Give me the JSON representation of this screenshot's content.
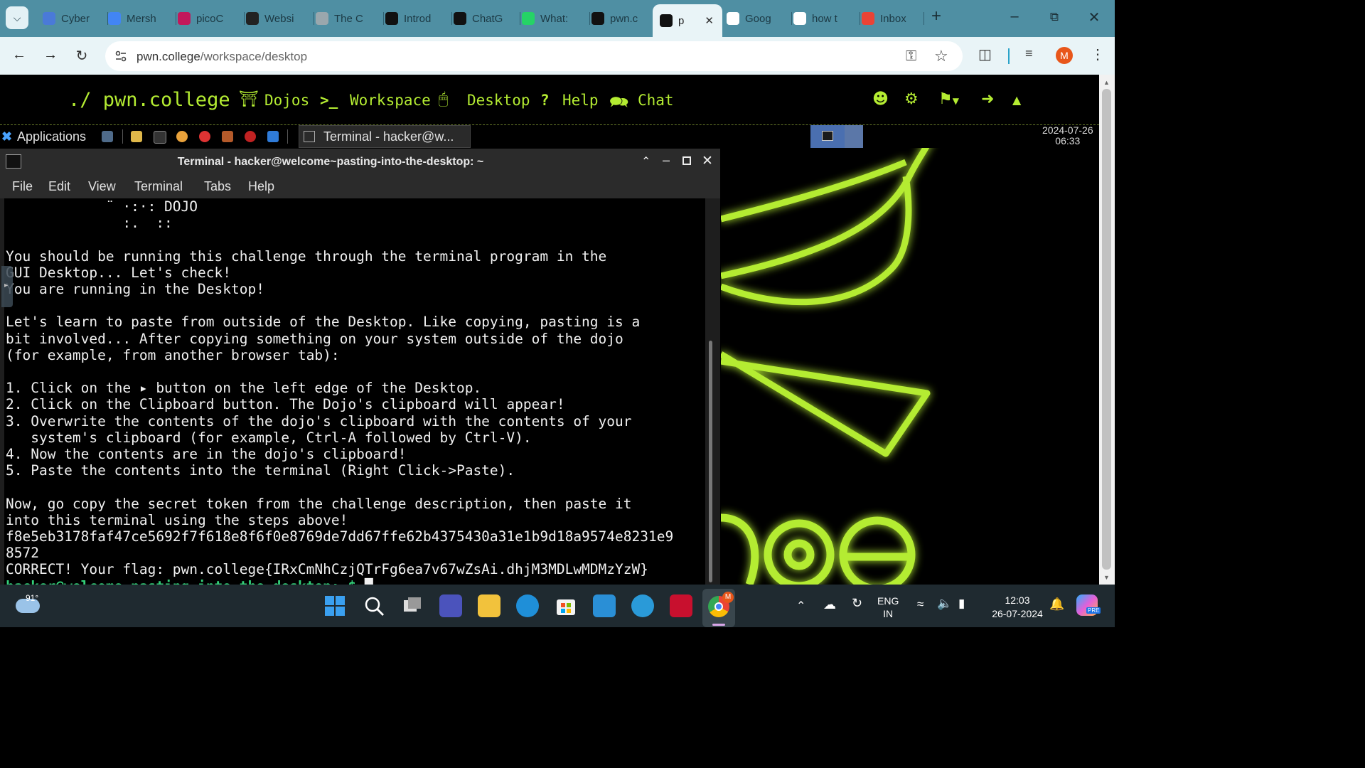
{
  "browser": {
    "tabs": [
      {
        "label": "Cyber",
        "icon": "cyber-icon",
        "color": "#4a7ad8"
      },
      {
        "label": "Mersh",
        "icon": "docs-icon",
        "color": "#4285f4"
      },
      {
        "label": "picoC",
        "icon": "picoctf-icon",
        "color": "#c2185b"
      },
      {
        "label": "Websi",
        "icon": "web-icon",
        "color": "#222222"
      },
      {
        "label": "The C",
        "icon": "loading-icon",
        "color": "#9aa7ad"
      },
      {
        "label": "Introd",
        "icon": "chatgpt-icon",
        "color": "#111111"
      },
      {
        "label": "ChatG",
        "icon": "chatgpt-icon",
        "color": "#111111"
      },
      {
        "label": "What:",
        "icon": "whatsapp-icon",
        "color": "#25d366"
      },
      {
        "label": "pwn.c",
        "icon": "pwn-icon",
        "color": "#111111"
      },
      {
        "label": "p",
        "icon": "pwn-icon",
        "color": "#111111",
        "active": true
      },
      {
        "label": "Goog",
        "icon": "google-icon",
        "color": "#ffffff"
      },
      {
        "label": "how t",
        "icon": "google-icon",
        "color": "#ffffff"
      },
      {
        "label": "Inbox",
        "icon": "gmail-icon",
        "color": "#ea4335"
      }
    ],
    "new_tab": "+",
    "url_host": "pwn.college",
    "url_path": "/workspace/desktop",
    "profile_initial": "M"
  },
  "site_nav": {
    "brand": "./ pwn.college",
    "items": [
      "Dojos",
      "Workspace",
      "Desktop",
      "Help",
      "Chat"
    ]
  },
  "xfce": {
    "applications": "Applications",
    "task": "Terminal - hacker@w...",
    "date": "2024-07-26",
    "time": "06:33"
  },
  "terminal": {
    "title": "Terminal - hacker@welcome~pasting-into-the-desktop: ~",
    "menu": [
      "File",
      "Edit",
      "View",
      "Terminal",
      "Tabs",
      "Help"
    ],
    "lines": [
      "            ¨ ·:·: DOJO",
      "              :.  ::",
      "",
      "You should be running this challenge through the terminal program in the",
      "GUI Desktop... Let's check!",
      "You are running in the Desktop!",
      "",
      "Let's learn to paste from outside of the Desktop. Like copying, pasting is a",
      "bit involved... After copying something on your system outside of the dojo",
      "(for example, from another browser tab):",
      "",
      "1. Click on the ▸ button on the left edge of the Desktop.",
      "2. Click on the Clipboard button. The Dojo's clipboard will appear!",
      "3. Overwrite the contents of the dojo's clipboard with the contents of your",
      "   system's clipboard (for example, Ctrl-A followed by Ctrl-V).",
      "4. Now the contents are in the dojo's clipboard!",
      "5. Paste the contents into the terminal (Right Click->Paste).",
      "",
      "Now, go copy the secret token from the challenge description, then paste it",
      "into this terminal using the steps above!",
      "f8e5eb3178faf47ce5692f7f618e8f6f0e8769de7dd67ffe62b4375430a31e1b9d18a9574e8231e9",
      "8572",
      "CORRECT! Your flag: pwn.college{IRxCmNhCzjQTrFg6ea7v67wZsAi.dhjM3MDLwMDMzYzW}"
    ],
    "prompt": "hacker@welcome~pasting-into-the-desktop:~$"
  },
  "taskbar": {
    "weather_temp": "91°",
    "lang_top": "ENG",
    "lang_bottom": "IN",
    "time": "12:03",
    "date": "26-07-2024",
    "chrome_badge": "M",
    "copilot_badge": "PRE"
  },
  "colors": {
    "neon": "#b4ec32",
    "tabbar": "#4f8fa3",
    "terminal_bg": "#000000"
  }
}
